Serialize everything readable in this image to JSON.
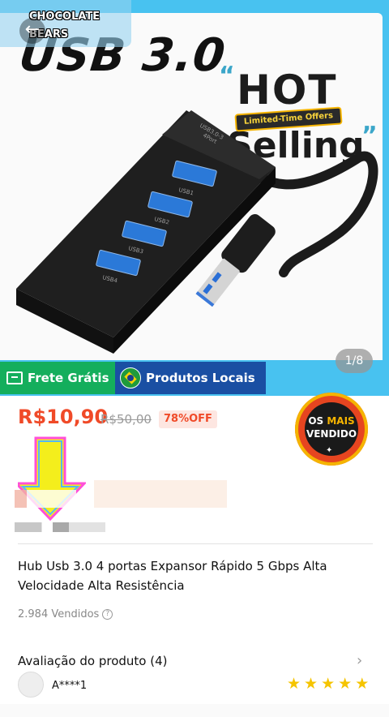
{
  "hero": {
    "brand_lines": "CHOCOLATE\nBEARS",
    "product_heading": "USB 3.0",
    "promo_hot": "HOT",
    "promo_selling": "Selling",
    "promo_banner": "Limited-Time Offers",
    "image_counter": "1/8"
  },
  "badges": {
    "free_shipping": "Frete Grátis",
    "local_products": "Produtos Locais",
    "best_seller_line1_a": "OS",
    "best_seller_line1_b": "MAIS",
    "best_seller_line2": "VENDIDO"
  },
  "price": {
    "current": "R$10,90",
    "original": "R$50,00",
    "discount": "78%OFF"
  },
  "product": {
    "title": "Hub Usb 3.0 4 portas Expansor Rápido 5 Gbps Alta Velocidade Alta Resistência",
    "sold": "2.984 Vendidos"
  },
  "reviews": {
    "title": "Avaliação do produto (4)",
    "reviewer": "A****1",
    "rating": 5
  },
  "colors": {
    "accent": "#f04a28",
    "hero_border": "#48c2f0",
    "free_shipping_bg": "#14ae5c",
    "local_bg": "#1a4fa3",
    "star": "#f5c400"
  }
}
